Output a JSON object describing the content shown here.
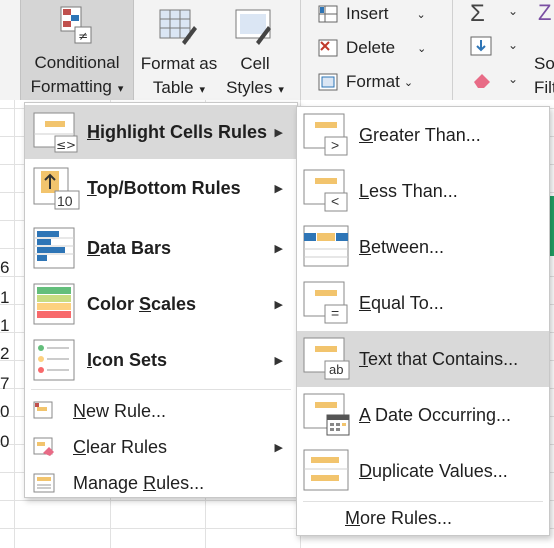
{
  "ribbon": {
    "conditional_formatting": {
      "line1": "Conditional",
      "line2": "Formatting"
    },
    "format_as_table": {
      "line1": "Format as",
      "line2": "Table"
    },
    "cell_styles": {
      "line1": "Cell",
      "line2": "Styles"
    },
    "insert": "Insert",
    "delete": "Delete",
    "format": "Format",
    "sort_partial": "So",
    "filter_partial": "Filt"
  },
  "row_values": [
    "6",
    "1",
    "1",
    "2",
    "7",
    "0",
    "0"
  ],
  "main_menu": {
    "items": [
      {
        "pre": "",
        "key": "H",
        "post": "ighlight Cells Rules",
        "icon": "highlight-cells-icon"
      },
      {
        "pre": "",
        "key": "T",
        "post": "op/Bottom Rules",
        "icon": "top-bottom-icon"
      },
      {
        "pre": "",
        "key": "D",
        "post": "ata Bars",
        "icon": "data-bars-icon"
      },
      {
        "pre": "Color ",
        "key": "S",
        "post": "cales",
        "icon": "color-scales-icon"
      },
      {
        "pre": "",
        "key": "I",
        "post": "con Sets",
        "icon": "icon-sets-icon"
      }
    ],
    "new_rule": {
      "pre": "",
      "key": "N",
      "post": "ew Rule..."
    },
    "clear_rules": {
      "pre": "",
      "key": "C",
      "post": "lear Rules"
    },
    "manage_rules": {
      "pre": "Manage ",
      "key": "R",
      "post": "ules..."
    },
    "top_bottom_badge": "10"
  },
  "sub_menu": {
    "items": [
      {
        "pre": "",
        "key": "G",
        "post": "reater Than...",
        "badge": ">"
      },
      {
        "pre": "",
        "key": "L",
        "post": "ess Than...",
        "badge": "<"
      },
      {
        "pre": "",
        "key": "B",
        "post": "etween...",
        "badge": ""
      },
      {
        "pre": "",
        "key": "E",
        "post": "qual To...",
        "badge": "="
      },
      {
        "pre": "",
        "key": "T",
        "post": "ext that Contains...",
        "badge": "ab"
      },
      {
        "pre": "",
        "key": "A",
        "post": " Date Occurring...",
        "badge": ""
      },
      {
        "pre": "",
        "key": "D",
        "post": "uplicate Values...",
        "badge": ""
      }
    ],
    "more_rules": {
      "pre": "",
      "key": "M",
      "post": "ore Rules..."
    }
  },
  "colors": {
    "highlight": "#d9d9d9",
    "orange": "#f2c46d",
    "blue": "#2e75b6"
  }
}
